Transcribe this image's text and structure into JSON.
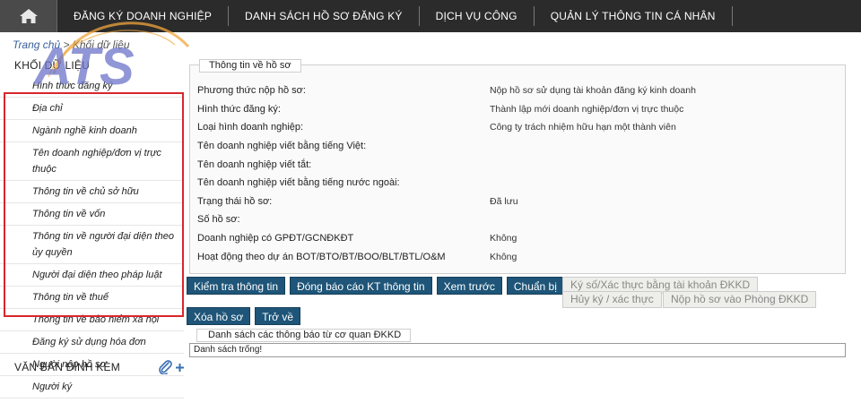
{
  "nav": {
    "home_icon": "home-icon",
    "items": [
      "ĐĂNG KÝ DOANH NGHIỆP",
      "DANH SÁCH HỒ SƠ ĐĂNG KÝ",
      "DỊCH VỤ CÔNG",
      "QUẢN LÝ THÔNG TIN CÁ NHÂN"
    ]
  },
  "breadcrumb": {
    "home": "Trang chủ",
    "separator": ">",
    "current": "Khối dữ liệu"
  },
  "logo": {
    "text": "ATS",
    "color": "#6b74c9",
    "swoosh_color": "#f0a63c"
  },
  "sidebar": {
    "title": "KHỐI DỮ LIỆU",
    "items": [
      "Hình thức đăng ký",
      "Địa chỉ",
      "Ngành nghề kinh doanh",
      "Tên doanh nghiệp/đơn vị trực thuộc",
      "Thông tin về chủ sở hữu",
      "Thông tin về vốn",
      "Thông tin về người đại diện theo ủy quyền",
      "Người đại diện theo pháp luật",
      "Thông tin về thuế",
      "Thông tin về bảo hiểm xã hội",
      "Đăng ký sử dụng hóa đơn",
      "Người nộp hồ sơ",
      "Người ký"
    ],
    "attachments_label": "VĂN BẢN ĐÍNH KÈM",
    "attachments_icon": "paperclip-add-icon",
    "highlight_color": "#d9262c"
  },
  "profile": {
    "legend": "Thông tin về hồ sơ",
    "rows": [
      {
        "label": "Phương thức nộp hồ sơ:",
        "value": "Nộp hồ sơ sử dụng tài khoản đăng ký kinh doanh"
      },
      {
        "label": "Hình thức đăng ký:",
        "value": "Thành lập mới doanh nghiệp/đơn vị trực thuộc"
      },
      {
        "label": "Loại hình doanh nghiệp:",
        "value": "Công ty trách nhiệm hữu hạn một thành viên"
      },
      {
        "label": "Tên doanh nghiệp viết bằng tiếng Việt:",
        "value": ""
      },
      {
        "label": "Tên doanh nghiệp viết tắt:",
        "value": ""
      },
      {
        "label": "Tên doanh nghiệp viết bằng tiếng nước ngoài:",
        "value": ""
      },
      {
        "label": "Trạng thái hồ sơ:",
        "value": "Đã lưu"
      },
      {
        "label": "Số hồ sơ:",
        "value": ""
      },
      {
        "label": "Doanh nghiệp có GPĐT/GCNĐKĐT",
        "value": "Không"
      },
      {
        "label": "Hoạt động theo dự án BOT/BTO/BT/BOO/BLT/BTL/O&M",
        "value": "Không"
      }
    ]
  },
  "buttons": {
    "check": "Kiểm tra thông tin",
    "report": "Đóng báo cáo KT thông tin",
    "preview": "Xem trước",
    "prepare": "Chuẩn bị",
    "sign": "Ký số/Xác thực bằng tài khoản ĐKKD",
    "cancel_sign": "Hủy ký / xác thực",
    "submit": "Nộp hồ sơ vào Phòng ĐKKD",
    "delete": "Xóa hồ sơ",
    "back": "Trở về"
  },
  "notices": {
    "legend": "Danh sách các thông báo từ cơ quan ĐKKD",
    "empty": "Danh sách trống!"
  },
  "colors": {
    "nav_bg": "#2b2b2b",
    "button_bg": "#1e5578",
    "disabled_bg": "#eeeeea"
  }
}
